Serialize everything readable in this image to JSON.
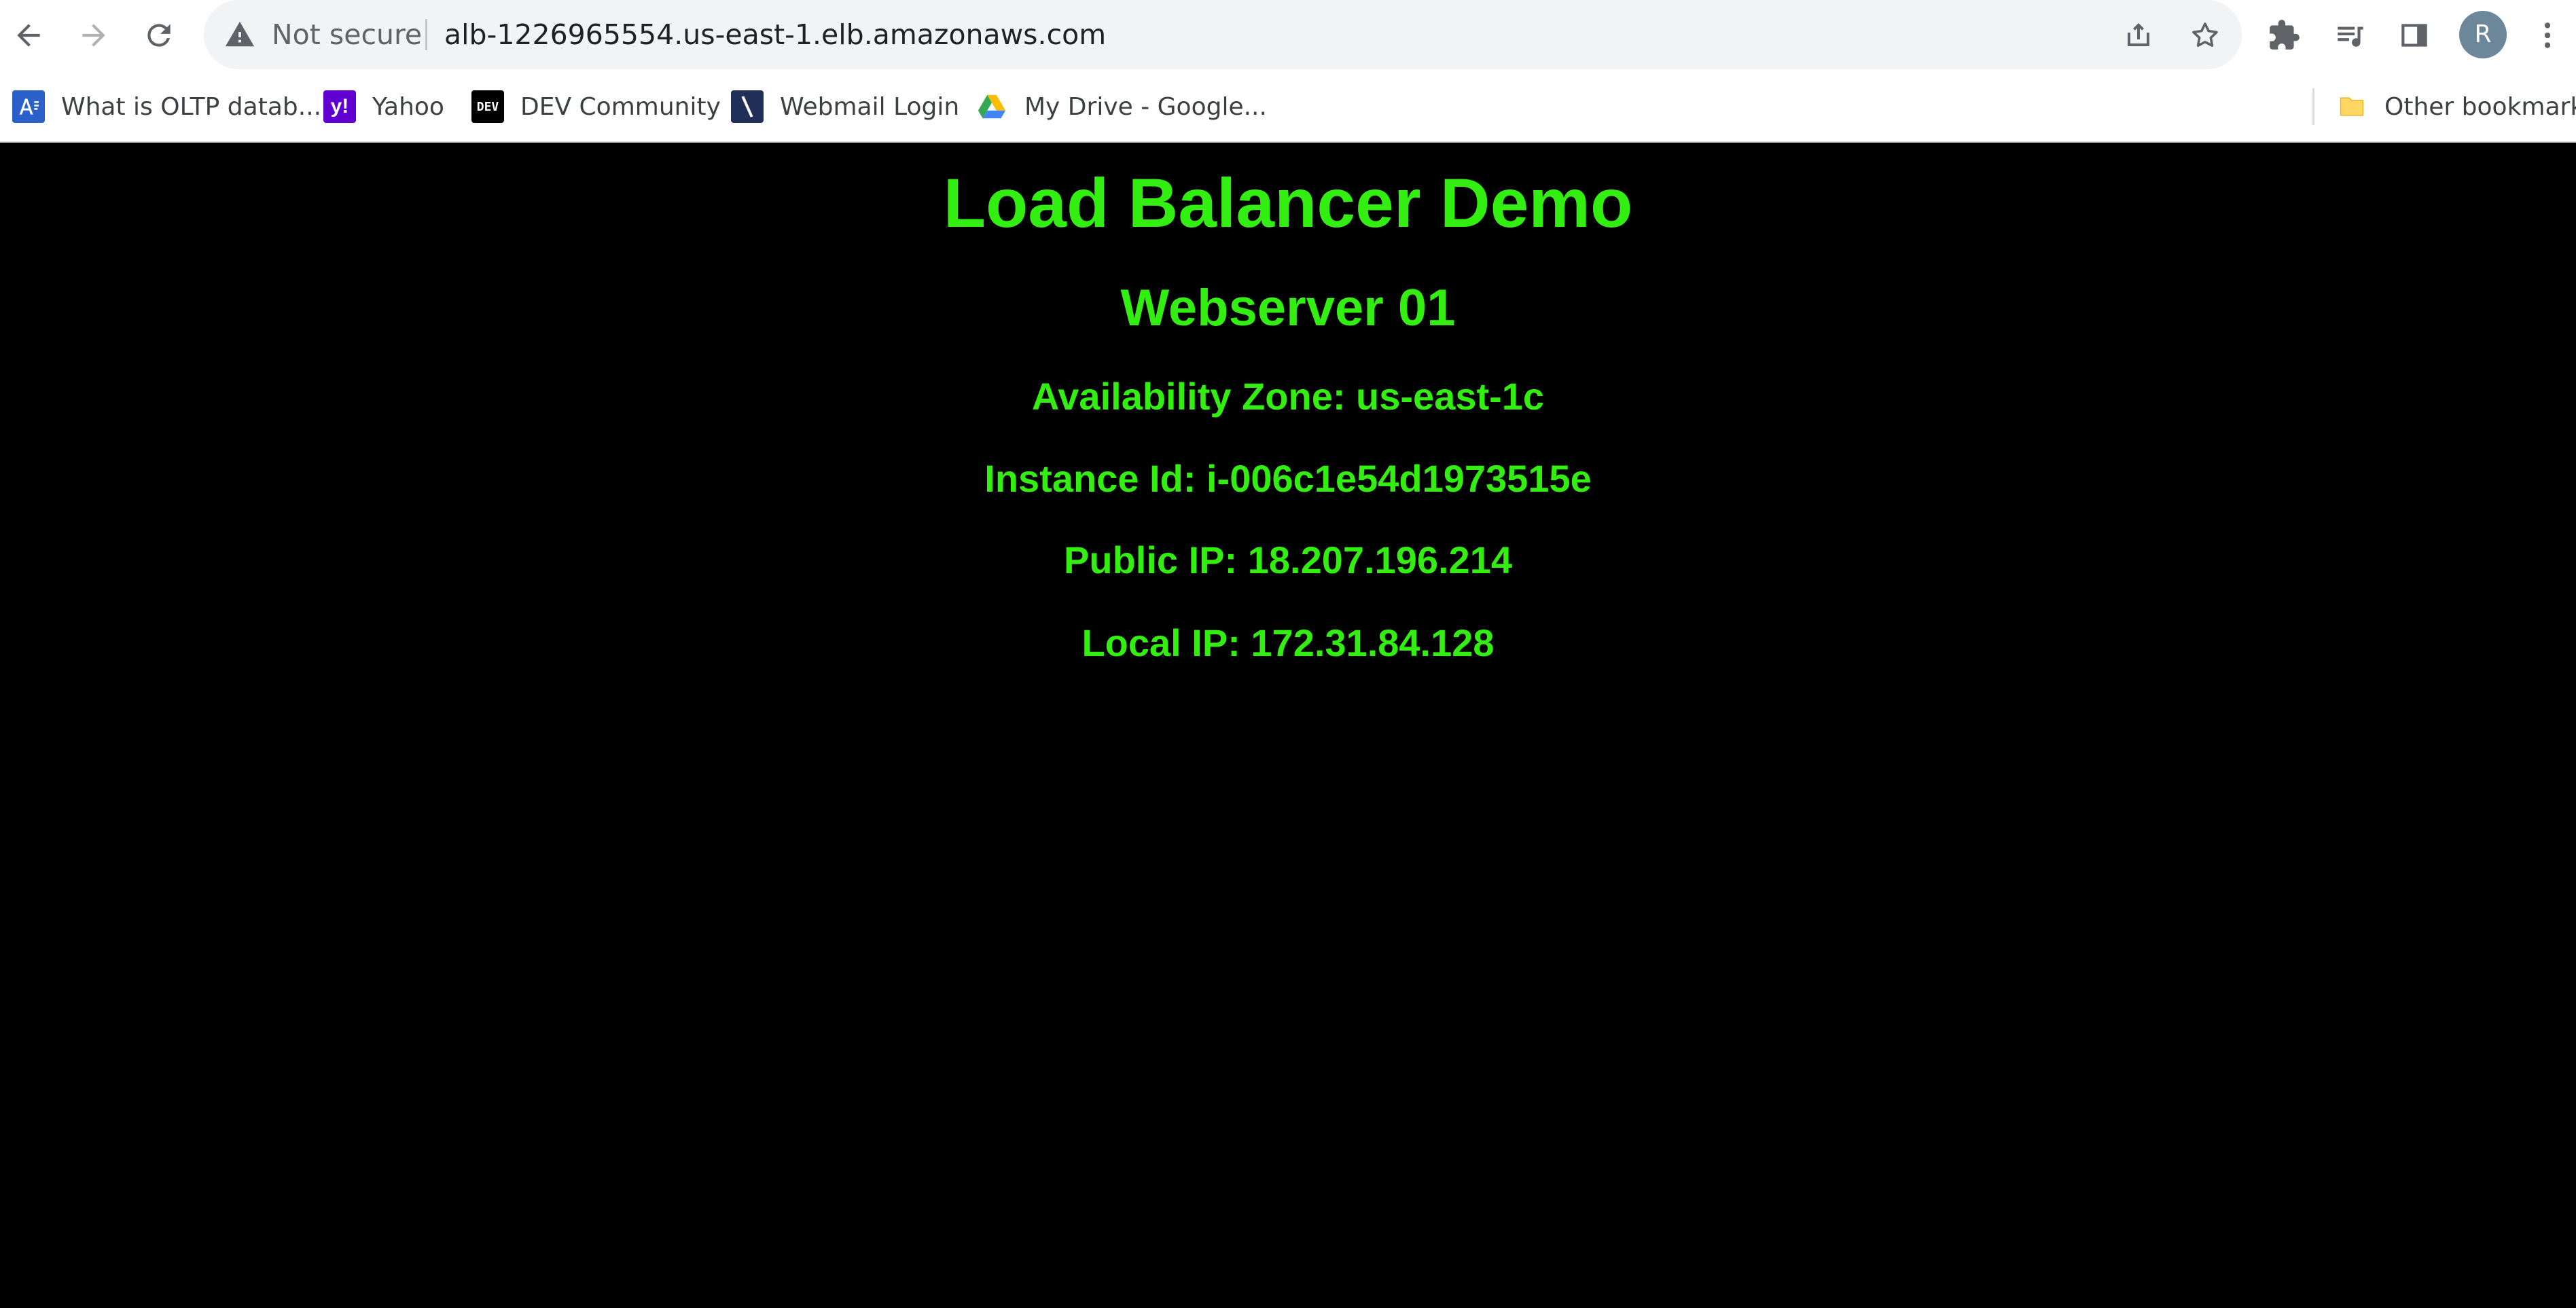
{
  "browser": {
    "security_label": "Not secure",
    "url": "alb-1226965554.us-east-1.elb.amazonaws.com",
    "profile_initial": "R",
    "icons": [
      "back-icon",
      "forward-icon",
      "reload-icon",
      "warning-icon",
      "share-icon",
      "star-icon",
      "extensions-icon",
      "reading-list-icon",
      "side-panel-icon",
      "menu-icon"
    ]
  },
  "bookmarks": {
    "items": [
      {
        "label": "What is OLTP datab...",
        "icon": "a-favicon",
        "color": "#2b5fc9"
      },
      {
        "label": "Yahoo",
        "icon": "yahoo-favicon",
        "color": "#6001d2"
      },
      {
        "label": "DEV Community",
        "icon": "dev-favicon",
        "color": "#000000"
      },
      {
        "label": "Webmail Login",
        "icon": "webmail-favicon",
        "color": "#1f2f57"
      },
      {
        "label": "My Drive - Google...",
        "icon": "drive-favicon",
        "color": "#34a853"
      }
    ],
    "other_label": "Other bookmarks"
  },
  "page": {
    "title": "Load Balancer Demo",
    "server": "Webserver 01",
    "availability_zone": "Availability Zone: us-east-1c",
    "instance_id": "Instance Id: i-006c1e54d1973515e",
    "public_ip": "Public IP: 18.207.196.214",
    "local_ip": "Local IP: 172.31.84.128",
    "text_color": "#33ee11",
    "background": "#000000"
  }
}
